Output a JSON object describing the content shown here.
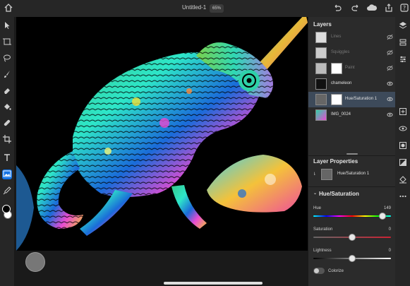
{
  "header": {
    "title": "Untitled-1",
    "zoom": "65%",
    "icons": [
      "home-icon",
      "undo-icon",
      "redo-icon",
      "cloud-icon",
      "share-icon"
    ]
  },
  "tools": [
    "select-icon",
    "transform-icon",
    "lasso-icon",
    "brush-icon",
    "eraser-icon",
    "fill-icon",
    "healing-icon",
    "crop-icon",
    "type-icon",
    "image-icon",
    "eyedropper-icon"
  ],
  "layers_panel": {
    "title": "Layers",
    "items": [
      {
        "name": "Lines",
        "visible": false
      },
      {
        "name": "Squiggles",
        "visible": false
      },
      {
        "name": "Paint",
        "visible": false
      },
      {
        "name": "chameleon",
        "visible": true
      },
      {
        "name": "Hue/Saturation 1",
        "visible": true,
        "selected": true
      },
      {
        "name": "IMG_0024",
        "visible": true
      }
    ]
  },
  "properties": {
    "title": "Layer Properties",
    "layer_name": "Hue/Saturation 1"
  },
  "hue_saturation": {
    "title": "Hue/Saturation",
    "hue_label": "Hue",
    "hue_value": "149",
    "saturation_label": "Saturation",
    "saturation_value": "0",
    "lightness_label": "Lightness",
    "lightness_value": "0",
    "colorize_label": "Colorize",
    "colorize_on": false
  },
  "colors": {
    "accent": "#1473e6",
    "selected_row": "#3d4a5a"
  }
}
